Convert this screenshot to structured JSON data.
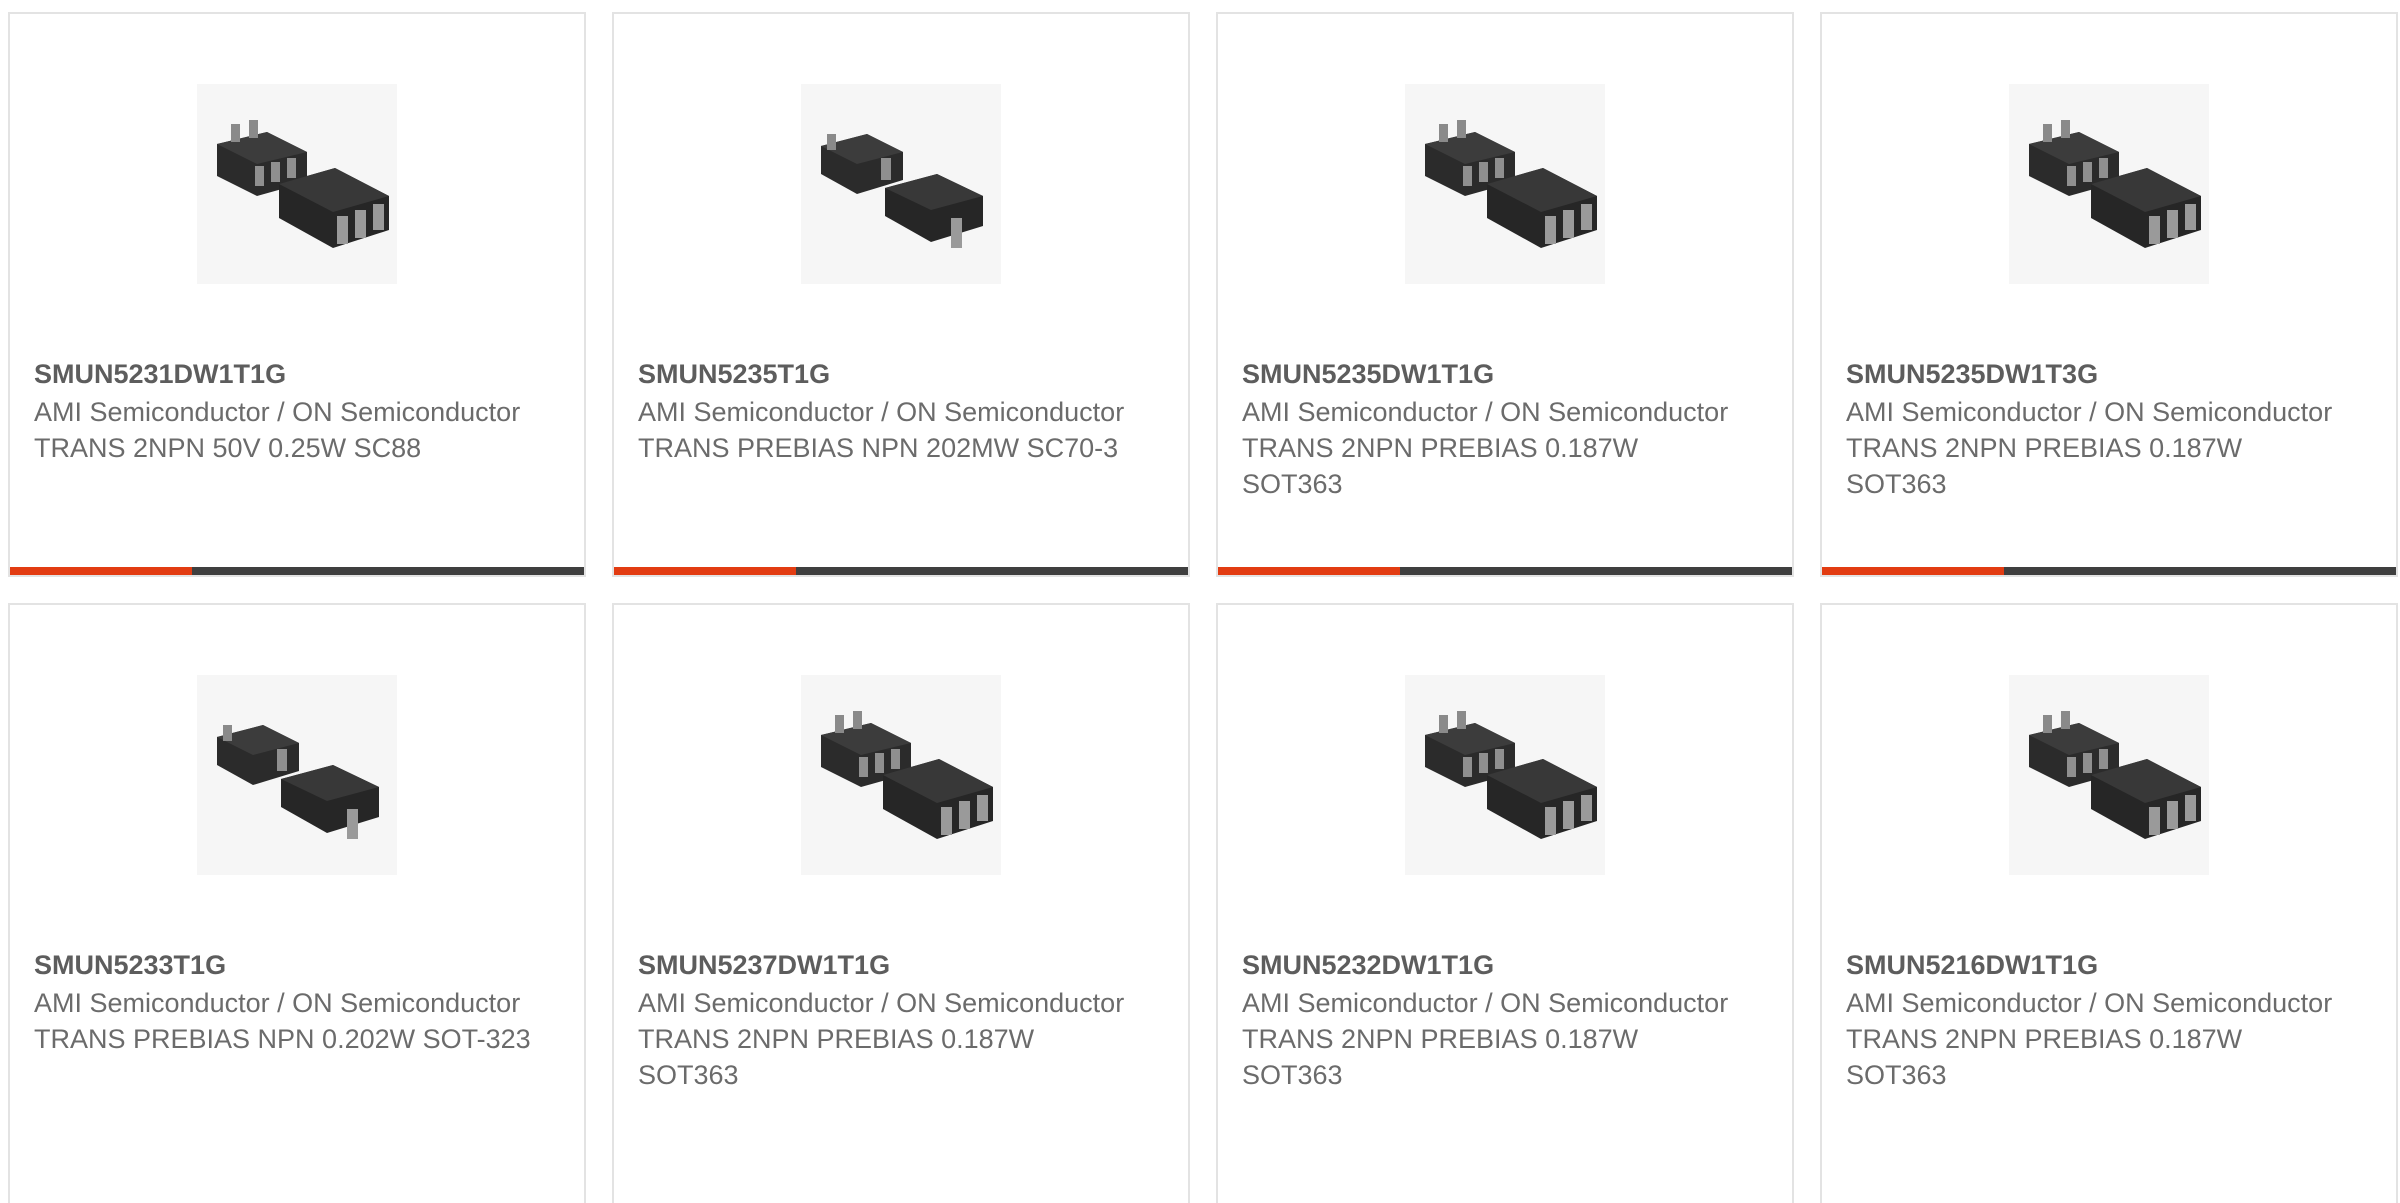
{
  "colors": {
    "accent": "#e23c12",
    "bar": "#3f3f3f",
    "text": "#6b6b6b",
    "border": "#e3e3e3"
  },
  "products": [
    {
      "part_number": "SMUN5231DW1T1G",
      "manufacturer": "AMI Semiconductor / ON Semiconductor",
      "description": "TRANS 2NPN 50V 0.25W SC88",
      "image_icon": "sot363-chip-image"
    },
    {
      "part_number": "SMUN5235T1G",
      "manufacturer": "AMI Semiconductor / ON Semiconductor",
      "description": "TRANS PREBIAS NPN 202MW SC70-3",
      "image_icon": "sc70-chip-image"
    },
    {
      "part_number": "SMUN5235DW1T1G",
      "manufacturer": "AMI Semiconductor / ON Semiconductor",
      "description": "TRANS 2NPN PREBIAS 0.187W SOT363",
      "image_icon": "sot363-chip-image"
    },
    {
      "part_number": "SMUN5235DW1T3G",
      "manufacturer": "AMI Semiconductor / ON Semiconductor",
      "description": "TRANS 2NPN PREBIAS 0.187W SOT363",
      "image_icon": "sot363-chip-image"
    },
    {
      "part_number": "SMUN5233T1G",
      "manufacturer": "AMI Semiconductor / ON Semiconductor",
      "description": "TRANS PREBIAS NPN 0.202W SOT-323",
      "image_icon": "sc70-chip-image"
    },
    {
      "part_number": "SMUN5237DW1T1G",
      "manufacturer": "AMI Semiconductor / ON Semiconductor",
      "description": "TRANS 2NPN PREBIAS 0.187W SOT363",
      "image_icon": "sot363-chip-image"
    },
    {
      "part_number": "SMUN5232DW1T1G",
      "manufacturer": "AMI Semiconductor / ON Semiconductor",
      "description": "TRANS 2NPN PREBIAS 0.187W SOT363",
      "image_icon": "sot363-chip-image"
    },
    {
      "part_number": "SMUN5216DW1T1G",
      "manufacturer": "AMI Semiconductor / ON Semiconductor",
      "description": "TRANS 2NPN PREBIAS 0.187W SOT363",
      "image_icon": "sot363-chip-image"
    }
  ]
}
